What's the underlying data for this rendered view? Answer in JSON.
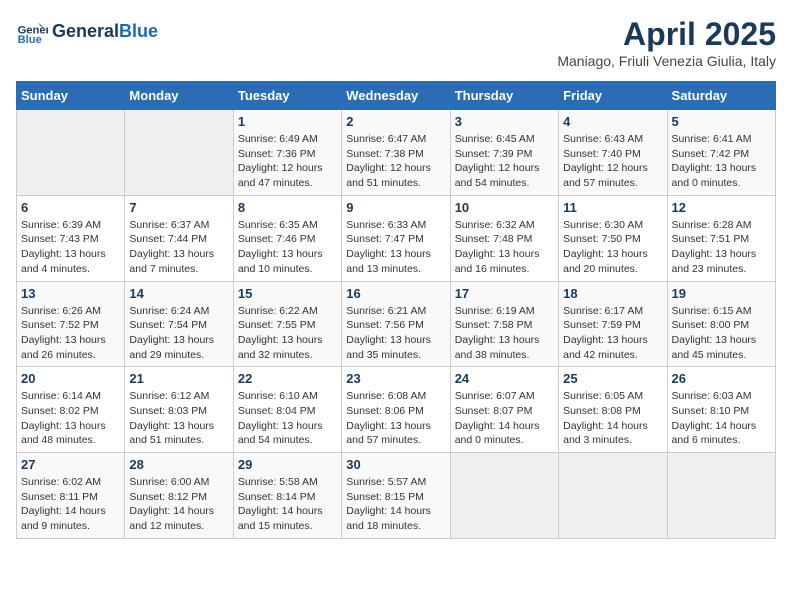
{
  "header": {
    "logo_line1": "General",
    "logo_line2": "Blue",
    "month_title": "April 2025",
    "location": "Maniago, Friuli Venezia Giulia, Italy"
  },
  "weekdays": [
    "Sunday",
    "Monday",
    "Tuesday",
    "Wednesday",
    "Thursday",
    "Friday",
    "Saturday"
  ],
  "weeks": [
    [
      {
        "num": "",
        "detail": ""
      },
      {
        "num": "",
        "detail": ""
      },
      {
        "num": "1",
        "detail": "Sunrise: 6:49 AM\nSunset: 7:36 PM\nDaylight: 12 hours and 47 minutes."
      },
      {
        "num": "2",
        "detail": "Sunrise: 6:47 AM\nSunset: 7:38 PM\nDaylight: 12 hours and 51 minutes."
      },
      {
        "num": "3",
        "detail": "Sunrise: 6:45 AM\nSunset: 7:39 PM\nDaylight: 12 hours and 54 minutes."
      },
      {
        "num": "4",
        "detail": "Sunrise: 6:43 AM\nSunset: 7:40 PM\nDaylight: 12 hours and 57 minutes."
      },
      {
        "num": "5",
        "detail": "Sunrise: 6:41 AM\nSunset: 7:42 PM\nDaylight: 13 hours and 0 minutes."
      }
    ],
    [
      {
        "num": "6",
        "detail": "Sunrise: 6:39 AM\nSunset: 7:43 PM\nDaylight: 13 hours and 4 minutes."
      },
      {
        "num": "7",
        "detail": "Sunrise: 6:37 AM\nSunset: 7:44 PM\nDaylight: 13 hours and 7 minutes."
      },
      {
        "num": "8",
        "detail": "Sunrise: 6:35 AM\nSunset: 7:46 PM\nDaylight: 13 hours and 10 minutes."
      },
      {
        "num": "9",
        "detail": "Sunrise: 6:33 AM\nSunset: 7:47 PM\nDaylight: 13 hours and 13 minutes."
      },
      {
        "num": "10",
        "detail": "Sunrise: 6:32 AM\nSunset: 7:48 PM\nDaylight: 13 hours and 16 minutes."
      },
      {
        "num": "11",
        "detail": "Sunrise: 6:30 AM\nSunset: 7:50 PM\nDaylight: 13 hours and 20 minutes."
      },
      {
        "num": "12",
        "detail": "Sunrise: 6:28 AM\nSunset: 7:51 PM\nDaylight: 13 hours and 23 minutes."
      }
    ],
    [
      {
        "num": "13",
        "detail": "Sunrise: 6:26 AM\nSunset: 7:52 PM\nDaylight: 13 hours and 26 minutes."
      },
      {
        "num": "14",
        "detail": "Sunrise: 6:24 AM\nSunset: 7:54 PM\nDaylight: 13 hours and 29 minutes."
      },
      {
        "num": "15",
        "detail": "Sunrise: 6:22 AM\nSunset: 7:55 PM\nDaylight: 13 hours and 32 minutes."
      },
      {
        "num": "16",
        "detail": "Sunrise: 6:21 AM\nSunset: 7:56 PM\nDaylight: 13 hours and 35 minutes."
      },
      {
        "num": "17",
        "detail": "Sunrise: 6:19 AM\nSunset: 7:58 PM\nDaylight: 13 hours and 38 minutes."
      },
      {
        "num": "18",
        "detail": "Sunrise: 6:17 AM\nSunset: 7:59 PM\nDaylight: 13 hours and 42 minutes."
      },
      {
        "num": "19",
        "detail": "Sunrise: 6:15 AM\nSunset: 8:00 PM\nDaylight: 13 hours and 45 minutes."
      }
    ],
    [
      {
        "num": "20",
        "detail": "Sunrise: 6:14 AM\nSunset: 8:02 PM\nDaylight: 13 hours and 48 minutes."
      },
      {
        "num": "21",
        "detail": "Sunrise: 6:12 AM\nSunset: 8:03 PM\nDaylight: 13 hours and 51 minutes."
      },
      {
        "num": "22",
        "detail": "Sunrise: 6:10 AM\nSunset: 8:04 PM\nDaylight: 13 hours and 54 minutes."
      },
      {
        "num": "23",
        "detail": "Sunrise: 6:08 AM\nSunset: 8:06 PM\nDaylight: 13 hours and 57 minutes."
      },
      {
        "num": "24",
        "detail": "Sunrise: 6:07 AM\nSunset: 8:07 PM\nDaylight: 14 hours and 0 minutes."
      },
      {
        "num": "25",
        "detail": "Sunrise: 6:05 AM\nSunset: 8:08 PM\nDaylight: 14 hours and 3 minutes."
      },
      {
        "num": "26",
        "detail": "Sunrise: 6:03 AM\nSunset: 8:10 PM\nDaylight: 14 hours and 6 minutes."
      }
    ],
    [
      {
        "num": "27",
        "detail": "Sunrise: 6:02 AM\nSunset: 8:11 PM\nDaylight: 14 hours and 9 minutes."
      },
      {
        "num": "28",
        "detail": "Sunrise: 6:00 AM\nSunset: 8:12 PM\nDaylight: 14 hours and 12 minutes."
      },
      {
        "num": "29",
        "detail": "Sunrise: 5:58 AM\nSunset: 8:14 PM\nDaylight: 14 hours and 15 minutes."
      },
      {
        "num": "30",
        "detail": "Sunrise: 5:57 AM\nSunset: 8:15 PM\nDaylight: 14 hours and 18 minutes."
      },
      {
        "num": "",
        "detail": ""
      },
      {
        "num": "",
        "detail": ""
      },
      {
        "num": "",
        "detail": ""
      }
    ]
  ]
}
